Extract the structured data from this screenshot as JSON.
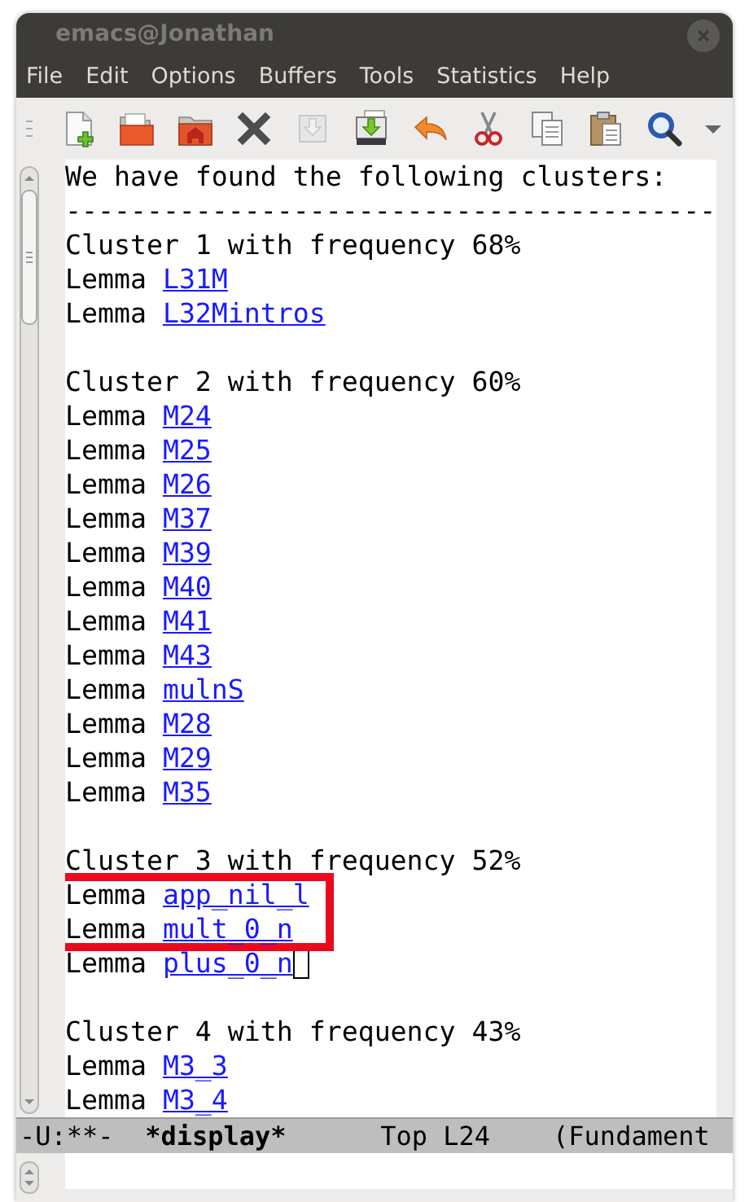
{
  "window": {
    "title": "emacs@Jonathan"
  },
  "menu": [
    "File",
    "Edit",
    "Options",
    "Buffers",
    "Tools",
    "Statistics",
    "Help"
  ],
  "toolbar": [
    {
      "kind": "new-file",
      "disabled": false
    },
    {
      "kind": "open",
      "disabled": false
    },
    {
      "kind": "home",
      "disabled": false
    },
    {
      "kind": "close",
      "disabled": false
    },
    {
      "kind": "save",
      "disabled": true
    },
    {
      "kind": "save-as",
      "disabled": false
    },
    {
      "kind": "undo",
      "disabled": false
    },
    {
      "kind": "cut",
      "disabled": false
    },
    {
      "kind": "copy",
      "disabled": false
    },
    {
      "kind": "paste",
      "disabled": false
    },
    {
      "kind": "search",
      "disabled": false
    }
  ],
  "buffer": {
    "lines": [
      {
        "kind": "text",
        "text": "We have found the following clusters:"
      },
      {
        "kind": "text",
        "text": "----------------------------------------"
      },
      {
        "kind": "text",
        "text": "Cluster 1 with frequency 68%"
      },
      {
        "kind": "lemma",
        "prefix": "Lemma",
        "link": "L31M",
        "highlighted": false,
        "cursor": false
      },
      {
        "kind": "lemma",
        "prefix": "Lemma",
        "link": "L32Mintros",
        "highlighted": false,
        "cursor": false
      },
      {
        "kind": "blank"
      },
      {
        "kind": "text",
        "text": "Cluster 2 with frequency 60%"
      },
      {
        "kind": "lemma",
        "prefix": "Lemma",
        "link": "M24",
        "highlighted": false,
        "cursor": false
      },
      {
        "kind": "lemma",
        "prefix": "Lemma",
        "link": "M25",
        "highlighted": false,
        "cursor": false
      },
      {
        "kind": "lemma",
        "prefix": "Lemma",
        "link": "M26",
        "highlighted": false,
        "cursor": false
      },
      {
        "kind": "lemma",
        "prefix": "Lemma",
        "link": "M37",
        "highlighted": false,
        "cursor": false
      },
      {
        "kind": "lemma",
        "prefix": "Lemma",
        "link": "M39",
        "highlighted": false,
        "cursor": false
      },
      {
        "kind": "lemma",
        "prefix": "Lemma",
        "link": "M40",
        "highlighted": false,
        "cursor": false
      },
      {
        "kind": "lemma",
        "prefix": "Lemma",
        "link": "M41",
        "highlighted": false,
        "cursor": false
      },
      {
        "kind": "lemma",
        "prefix": "Lemma",
        "link": "M43",
        "highlighted": false,
        "cursor": false
      },
      {
        "kind": "lemma",
        "prefix": "Lemma",
        "link": "mulnS",
        "highlighted": false,
        "cursor": false
      },
      {
        "kind": "lemma",
        "prefix": "Lemma",
        "link": "M28",
        "highlighted": false,
        "cursor": false
      },
      {
        "kind": "lemma",
        "prefix": "Lemma",
        "link": "M29",
        "highlighted": false,
        "cursor": false
      },
      {
        "kind": "lemma",
        "prefix": "Lemma",
        "link": "M35",
        "highlighted": false,
        "cursor": false
      },
      {
        "kind": "blank"
      },
      {
        "kind": "text",
        "text": "Cluster 3 with frequency 52%"
      },
      {
        "kind": "lemma",
        "prefix": "Lemma",
        "link": "app_nil_l",
        "highlighted": true,
        "cursor": false
      },
      {
        "kind": "lemma",
        "prefix": "Lemma",
        "link": "mult_0_n",
        "highlighted": true,
        "cursor": false
      },
      {
        "kind": "lemma",
        "prefix": "Lemma",
        "link": "plus_0_n",
        "highlighted": false,
        "cursor": true
      },
      {
        "kind": "blank"
      },
      {
        "kind": "text",
        "text": "Cluster 4 with frequency 43%"
      },
      {
        "kind": "lemma",
        "prefix": "Lemma",
        "link": "M3_3",
        "highlighted": false,
        "cursor": false
      },
      {
        "kind": "lemma",
        "prefix": "Lemma",
        "link": "M3_4",
        "highlighted": false,
        "cursor": false
      }
    ]
  },
  "mode_line": {
    "status": "-U:**-",
    "buffer_name": "*display*",
    "position": "Top L24",
    "mode": "(Fundament"
  }
}
